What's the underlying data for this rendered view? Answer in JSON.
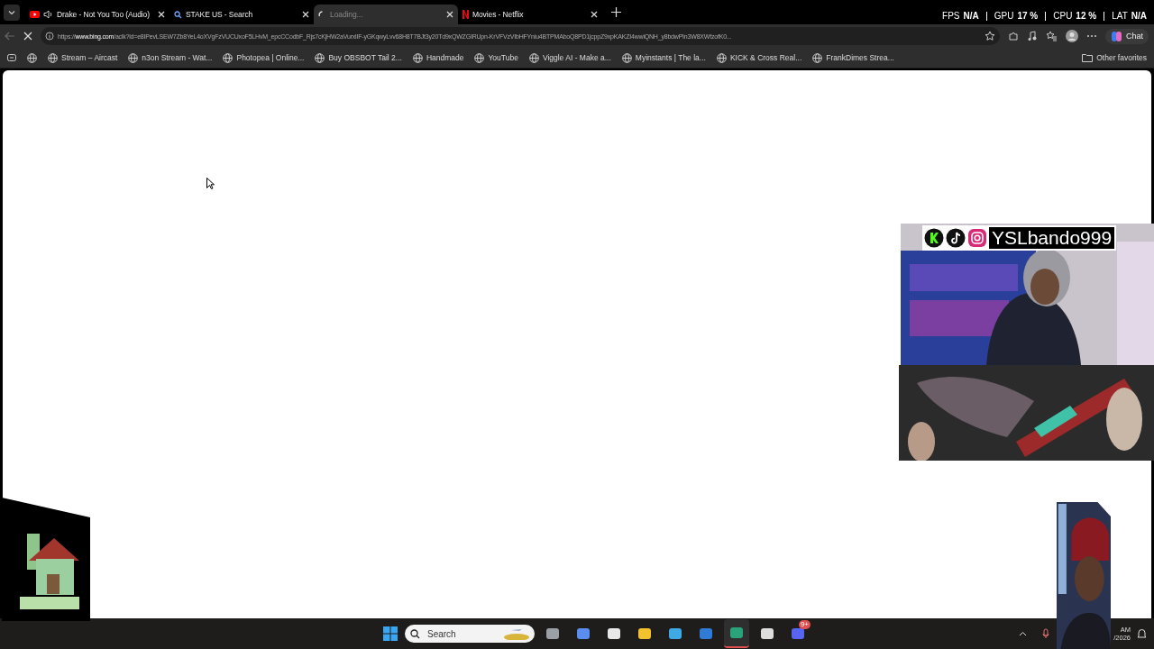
{
  "tabs": [
    {
      "label": "Drake - Not You Too (Audio)",
      "kind": "video",
      "audio": true,
      "selected": false
    },
    {
      "label": "STAKE US - Search",
      "kind": "search",
      "audio": false,
      "selected": false
    },
    {
      "label": "Loading...",
      "kind": "loading",
      "audio": false,
      "selected": true
    },
    {
      "label": "Movies - Netflix",
      "kind": "netflix",
      "audio": false,
      "selected": false
    }
  ],
  "stats": [
    {
      "label": "FPS",
      "value": "N/A"
    },
    {
      "label": "GPU",
      "value": "17 %"
    },
    {
      "label": "CPU",
      "value": "12 %"
    },
    {
      "label": "LAT",
      "value": "N/A"
    }
  ],
  "address": {
    "url": "https://**www.bing.com**/aclk?ld=e8IPevLSEW7Zb8YeL4oXVgFzVUCUxoF5LHvM_epcCCodbF_Rjs7cKjHW2aVurxlIF-yGKqwyLvv68H8T7BJt3y20Td9xQWZGIRUpn-KrVFVzVIbHFYniu4BTPMAboQ8PD1jcppZ9xpKAKZI4wwiQNH_y8bdwPIn3W8XWfzofK0..."
  },
  "chat_button": "Chat",
  "bookmarks": [
    "Stream – Aircast",
    "n3on Stream - Wat...",
    "Photopea | Online...",
    "Buy OBSBOT Tail 2...",
    "Handmade",
    "YouTube",
    "Viggle AI - Make a...",
    "Myinstants | The la...",
    "KICK & Cross Real...",
    "FrankDimes Strea..."
  ],
  "other_favorites": "Other favorites",
  "stream_overlay": {
    "handle": "YSLbando999"
  },
  "taskbar": {
    "search_placeholder": "Search",
    "apps": [
      {
        "kind": "taskview",
        "selected": false
      },
      {
        "kind": "copilot",
        "selected": false
      },
      {
        "kind": "store",
        "selected": false
      },
      {
        "kind": "files",
        "selected": false
      },
      {
        "kind": "photos",
        "selected": false
      },
      {
        "kind": "outlook",
        "selected": false
      },
      {
        "kind": "edge",
        "selected": true
      },
      {
        "kind": "obs",
        "selected": false
      },
      {
        "kind": "discord",
        "selected": false,
        "badge": "9+"
      }
    ],
    "clock": {
      "time": "AM",
      "date": "/2026"
    }
  }
}
